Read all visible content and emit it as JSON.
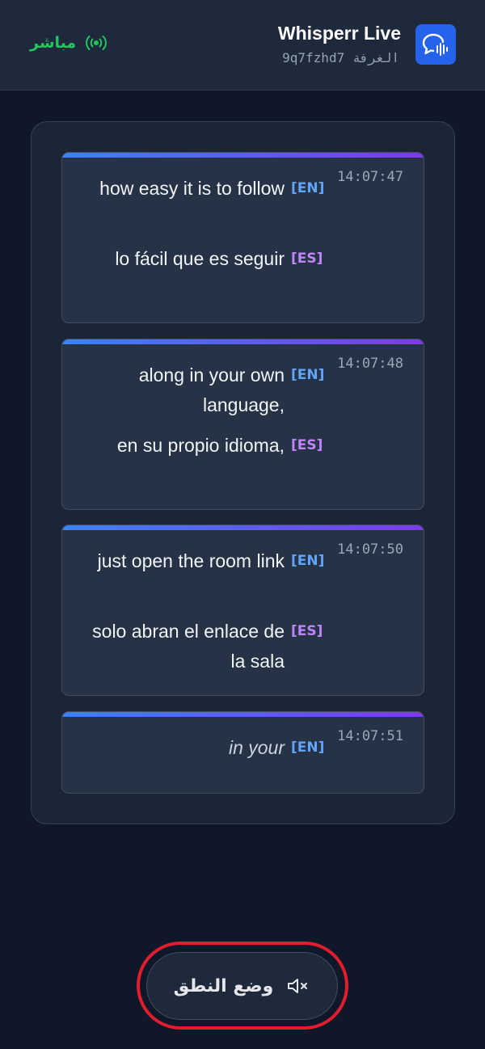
{
  "header": {
    "title": "Whisperr Live",
    "room_label": "الغرفة",
    "room_code": "9q7fzhd7",
    "live_label": "مباشر",
    "live_color": "#22c55e",
    "app_icon": "chat-bubble-audio-icon"
  },
  "feed": {
    "cards": [
      {
        "time": "14:07:47",
        "source_lang": "[EN]",
        "source_text": "how easy it is to follow",
        "target_lang": "[ES]",
        "target_text": "lo fácil que es seguir"
      },
      {
        "time": "14:07:48",
        "source_lang": "[EN]",
        "source_text": "along in your own language,",
        "target_lang": "[ES]",
        "target_text": "en su propio idioma,"
      },
      {
        "time": "14:07:50",
        "source_lang": "[EN]",
        "source_text": "just open the room link",
        "target_lang": "[ES]",
        "target_text": "solo abran el enlace de la sala"
      },
      {
        "time": "14:07:51",
        "source_lang": "[EN]",
        "source_text": "in your"
      }
    ]
  },
  "speak_button": {
    "label": "وضع النطق",
    "icon": "speaker-muted-icon"
  },
  "colors": {
    "accent_start": "#3b82f6",
    "accent_end": "#7c3aed",
    "en_tag": "#60a5fa",
    "es_tag": "#c084fc",
    "highlight_ring": "#e11d2e"
  }
}
